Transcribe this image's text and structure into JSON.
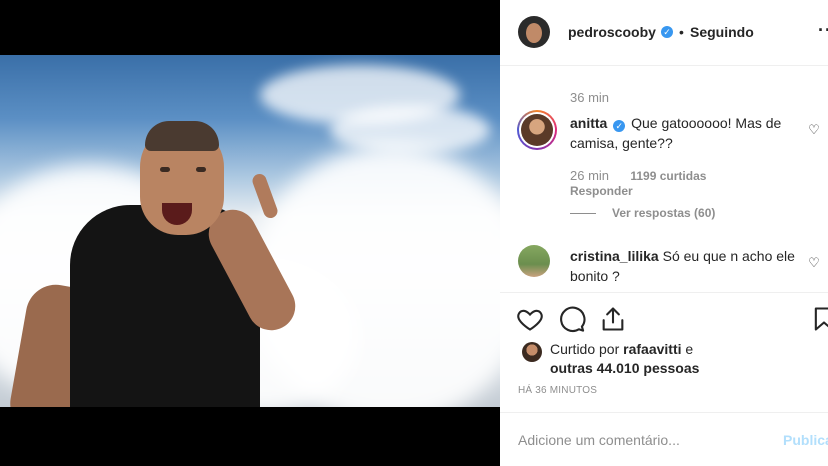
{
  "post": {
    "username": "pedroscooby",
    "verified": true,
    "separator": "•",
    "follow_status": "Seguindo",
    "more_label": "···"
  },
  "comments": [
    {
      "time": "36 min",
      "username": "anitta",
      "verified": true,
      "text": "Que gatoooooo! Mas de camisa, gente??",
      "meta_time": "26 min",
      "likes": "1199 curtidas",
      "reply_label": "Responder",
      "view_replies": "Ver respostas (60)"
    },
    {
      "username": "cristina_lilika",
      "text": "Só eu que n acho ele bonito ?"
    }
  ],
  "likes": {
    "prefix": "Curtido por",
    "user": "rafaavitti",
    "conjunction": "e",
    "others": "outras 44.010 pessoas"
  },
  "posted_ago": "HÁ 36 MINUTOS",
  "add_comment": {
    "placeholder": "Adicione um comentário...",
    "publish_label": "Publicar"
  },
  "icons": {
    "like": "heart-icon",
    "comment": "comment-icon",
    "share": "share-icon",
    "save": "bookmark-icon"
  },
  "colors": {
    "verified": "#3897f0",
    "publish_disabled": "#b2dffc",
    "secondary_text": "#8e8e8e"
  }
}
